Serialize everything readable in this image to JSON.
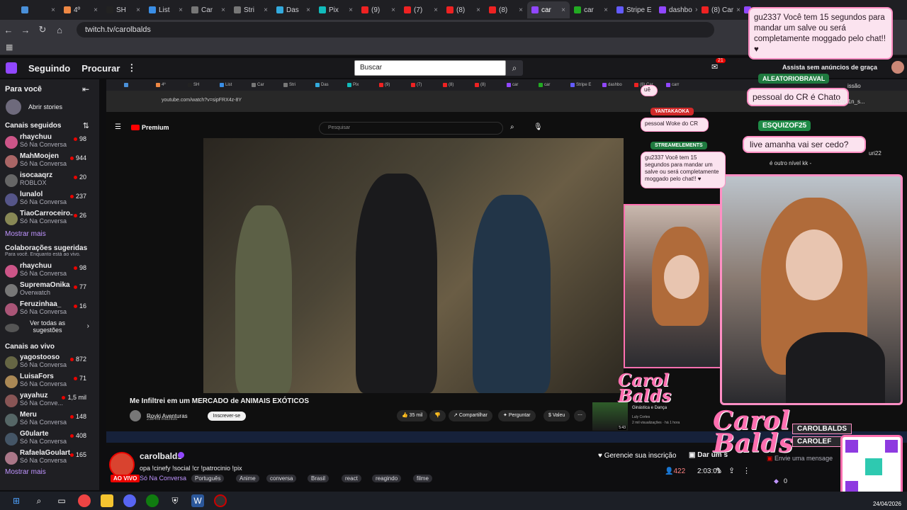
{
  "browser": {
    "tabs": [
      {
        "label": "",
        "color": "#4a90d9"
      },
      {
        "label": "4º",
        "color": "#e84"
      },
      {
        "label": "SH",
        "color": "#222"
      },
      {
        "label": "List",
        "color": "#3a8ee6"
      },
      {
        "label": "Car",
        "color": "#777"
      },
      {
        "label": "Stri",
        "color": "#777"
      },
      {
        "label": "Das",
        "color": "#3ad"
      },
      {
        "label": "Pix",
        "color": "#1bb"
      },
      {
        "label": "(9)",
        "color": "#e22"
      },
      {
        "label": "(7)",
        "color": "#e22"
      },
      {
        "label": "(8)",
        "color": "#e22"
      },
      {
        "label": "(8)",
        "color": "#e22"
      },
      {
        "label": "car",
        "color": "#9147ff",
        "active": true
      },
      {
        "label": "car",
        "color": "#2a2"
      },
      {
        "label": "Stripe E",
        "color": "#635bff"
      },
      {
        "label": "dashbo",
        "color": "#9147ff"
      },
      {
        "label": "(8) Car",
        "color": "#e22"
      },
      {
        "label": "carr",
        "color": "#9147ff"
      }
    ],
    "url": "twitch.tv/carolbalds"
  },
  "twitch_nav": {
    "following": "Seguindo",
    "browse": "Procurar",
    "search_placeholder": "Buscar",
    "notif_count": "21",
    "ad_free": "Assista sem anúncios de graça"
  },
  "sidebar": {
    "for_you": "Para você",
    "open_stories": "Abrir stories",
    "followed_header": "Canais seguidos",
    "followed": [
      {
        "name": "rhaychuu",
        "category": "Só Na Conversa",
        "viewers": "98",
        "color": "#c58"
      },
      {
        "name": "MahMoojen",
        "category": "Só Na Conversa",
        "viewers": "944",
        "color": "#a66"
      },
      {
        "name": "isocaaqrz",
        "category": "ROBLOX",
        "viewers": "20",
        "color": "#666"
      },
      {
        "name": "lunalol",
        "category": "Só Na Conversa",
        "viewers": "237",
        "color": "#558"
      },
      {
        "name": "TiaoCarroceiro...",
        "category": "Só Na Conversa",
        "viewers": "26",
        "color": "#885"
      }
    ],
    "show_more": "Mostrar mais",
    "suggested_header": "Colaborações sugeridas",
    "suggested_sub": "Para você. Enquanto está ao vivo.",
    "suggested": [
      {
        "name": "rhaychuu",
        "category": "Só Na Conversa",
        "viewers": "98",
        "color": "#c58"
      },
      {
        "name": "SupremaOnika",
        "category": "Overwatch",
        "viewers": "77",
        "color": "#777"
      },
      {
        "name": "Feruzinhaa_",
        "category": "Só Na Conversa",
        "viewers": "16",
        "color": "#a57"
      }
    ],
    "see_all_stories": "Ver todas as sugestões",
    "live_header": "Canais ao vivo",
    "live": [
      {
        "name": "yagostooso",
        "category": "Só Na Conversa",
        "viewers": "872",
        "color": "#664"
      },
      {
        "name": "LuisaFors",
        "category": "Só Na Conversa",
        "viewers": "71",
        "color": "#a85"
      },
      {
        "name": "yayahuz",
        "category": "Só Na Conve...",
        "viewers": "1,5 mil",
        "color": "#855"
      },
      {
        "name": "Meru",
        "category": "Só Na Conversa",
        "viewers": "148",
        "color": "#566"
      },
      {
        "name": "G0ularte",
        "category": "Só Na Conversa",
        "viewers": "408",
        "color": "#456"
      },
      {
        "name": "RafaelaGoulart",
        "category": "Só Na Conversa",
        "viewers": "165",
        "color": "#a78"
      }
    ],
    "show_more_2": "Mostrar mais"
  },
  "youtube": {
    "url": "youtube.com/watch?v=sipFRX4z-8Y",
    "logo": "Premium",
    "search_placeholder": "Pesquisar",
    "video_title": "Me Infiltrei em um MERCADO de ANIMAIS EXÓTICOS",
    "channel": "Royki Aventuras",
    "subs": "238 mil inscritos",
    "subscribe": "Inscrever-se",
    "likes": "35 mil",
    "share": "Compartilhar",
    "ask": "Perguntar",
    "thanks": "Valeu",
    "rec_title": "Ginástica e Dança",
    "rec_channel": "Luly Cortes",
    "rec_meta": "2 mil visualizações · há 1 hora",
    "rec_duration": "5:43"
  },
  "overlay": {
    "chat_msg_1": "gu2337 Você tem 15 segundos para mandar um salve ou será completamente moggado pelo chat!! ♥",
    "badge_aleatorio": "ALEATORIOBRAVAL",
    "chat_msg_2": "pessoal do CR é Chato",
    "badge_esquizo": "ESQUIZOF25",
    "chat_msg_3": "live amanha vai ser cedo?",
    "badge_streamelements": "STREAMELEMENTS",
    "small_badge_yanta": "YANTAKAOKA",
    "small_msg_woke": "pessoal Woke do CR",
    "small_msg_gu": "gu2337 Você tem 15 segundos para mandar um salve ou será completamente moggado pelo chat!! ♥",
    "ue": "uê",
    "logo_text": "Carol Balds",
    "social_1": "CAROLBALDS",
    "social_2": "CAROLEF",
    "chat_behind_1": "é outro nível kk -",
    "chat_behind_2": "m4rqu1n_s...",
    "chat_behind_3": "uri22",
    "chat_behind_4": "issão"
  },
  "stream_info": {
    "streamer": "carolbalds",
    "live": "AO VIVO",
    "title": "opa !cinefy !social !cr !patrocinio !pix",
    "category": "Só Na Conversa",
    "tags": [
      "Português",
      "Anime",
      "conversa",
      "Brasil",
      "react",
      "reagindo",
      "filme"
    ],
    "manage_sub": "Gerencie sua inscrição",
    "gift": "Dar um s",
    "viewers": "422",
    "uptime": "2:03:01"
  },
  "chat": {
    "input_placeholder": "Envie uma mensage",
    "points": "0"
  },
  "taskbar": {
    "date": "24/04/2026"
  }
}
